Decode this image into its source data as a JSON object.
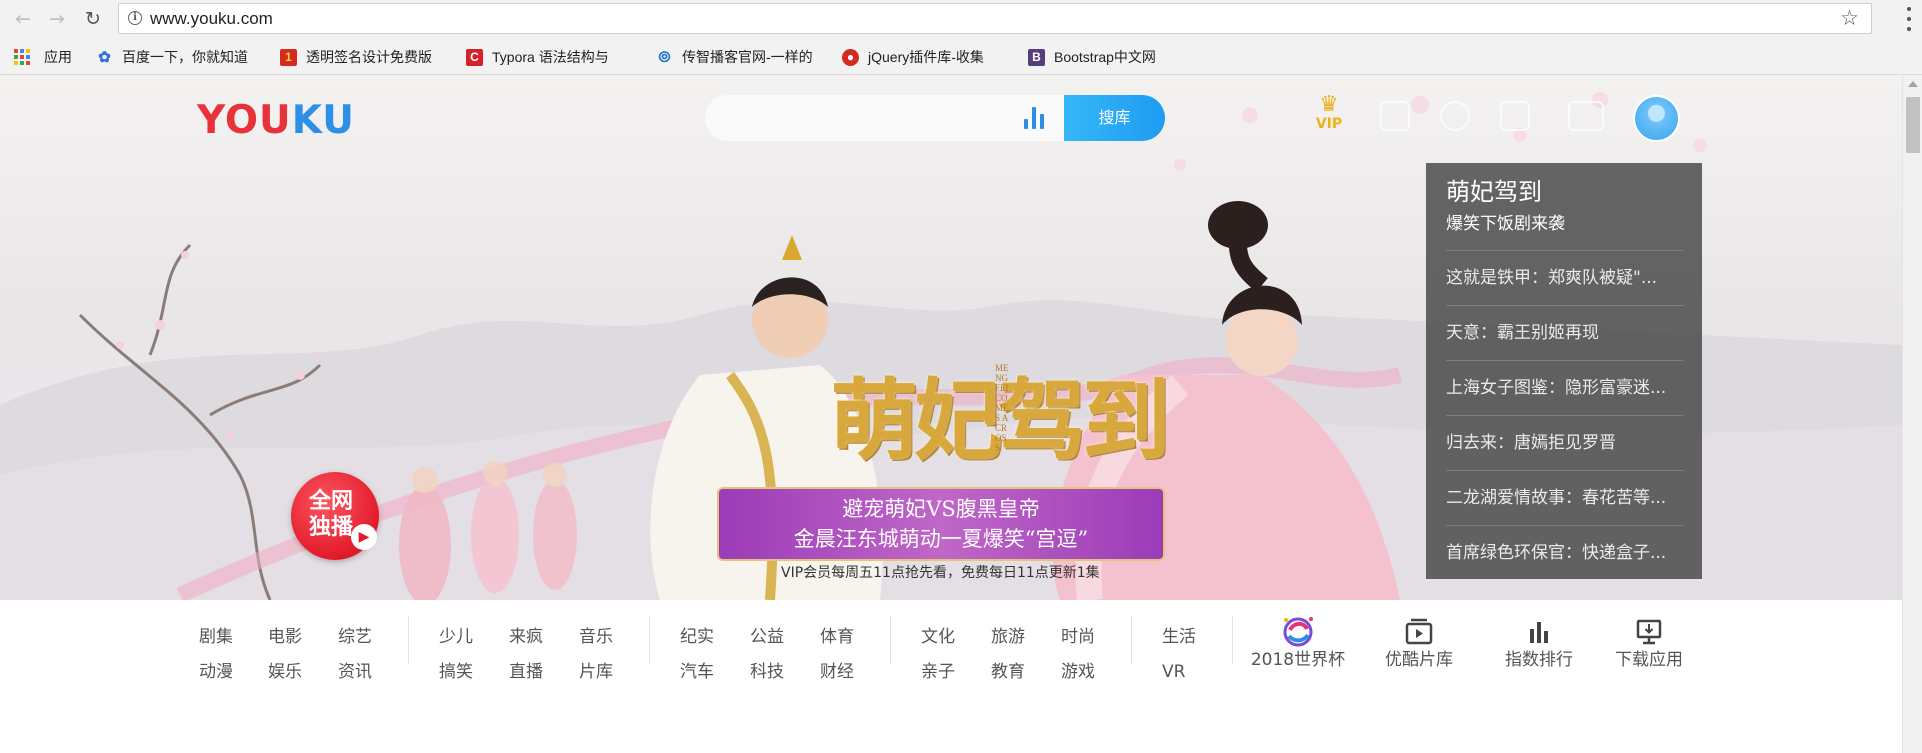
{
  "browser": {
    "url": "www.youku.com",
    "bookmarks": [
      {
        "label": "应用",
        "icon": "apps-grid-icon"
      },
      {
        "label": "百度一下，你就知道",
        "icon": "baidu-paw-icon"
      },
      {
        "label": "透明签名设计免费版",
        "icon": "signature-site-icon"
      },
      {
        "label": "Typora 语法结构与",
        "icon": "typora-site-icon"
      },
      {
        "label": "传智播客官网-一样的",
        "icon": "itcast-site-icon"
      },
      {
        "label": "jQuery插件库-收集",
        "icon": "jquery-plugin-site-icon"
      },
      {
        "label": "Bootstrap中文网",
        "icon": "bootstrap-b-icon"
      }
    ]
  },
  "header": {
    "logo_part1": "YOU",
    "logo_part2": "KU",
    "search_button": "搜库",
    "vip_label": "VIP",
    "brand_red": "#e8323a",
    "brand_blue": "#2e8fe7"
  },
  "banner": {
    "badge": "全网独播",
    "drama_title": "萌妃驾到",
    "drama_subtitle_en": "MENGFEI COMES ACROSS",
    "tagline_line1": "避宠萌妃VS腹黑皇帝",
    "tagline_line2": "金晨汪东城萌动一夏爆笑“宫逗”",
    "vip_note": "VIP会员每周五11点抢先看，免费每日11点更新1集"
  },
  "ranking": {
    "title": "萌妃驾到",
    "subtitle": "爆笑下饭剧来袭",
    "items": [
      "这就是铁甲：郑爽队被疑\"...",
      "天意：霸王别姬再现",
      "上海女子图鉴：隐形富豪迷...",
      "归去来：唐嫣拒见罗晋",
      "二龙湖爱情故事：春花苦等...",
      "首席绿色环保官：快递盒子..."
    ]
  },
  "categories": {
    "groups": [
      {
        "row1": [
          "剧集",
          "电影",
          "综艺"
        ],
        "row2": [
          "动漫",
          "娱乐",
          "资讯"
        ]
      },
      {
        "row1": [
          "少儿",
          "来疯",
          "音乐"
        ],
        "row2": [
          "搞笑",
          "直播",
          "片库"
        ]
      },
      {
        "row1": [
          "纪实",
          "公益",
          "体育"
        ],
        "row2": [
          "汽车",
          "科技",
          "财经"
        ]
      },
      {
        "row1": [
          "文化",
          "旅游",
          "时尚"
        ],
        "row2": [
          "亲子",
          "教育",
          "游戏"
        ]
      },
      {
        "row1": [
          "生活"
        ],
        "row2": [
          "VR"
        ]
      }
    ],
    "quick_links": [
      {
        "label": "2018世界杯",
        "icon": "world-cup-icon"
      },
      {
        "label": "优酷片库",
        "icon": "film-library-icon"
      },
      {
        "label": "指数排行",
        "icon": "bar-chart-icon"
      },
      {
        "label": "下载应用",
        "icon": "monitor-download-icon"
      }
    ]
  }
}
